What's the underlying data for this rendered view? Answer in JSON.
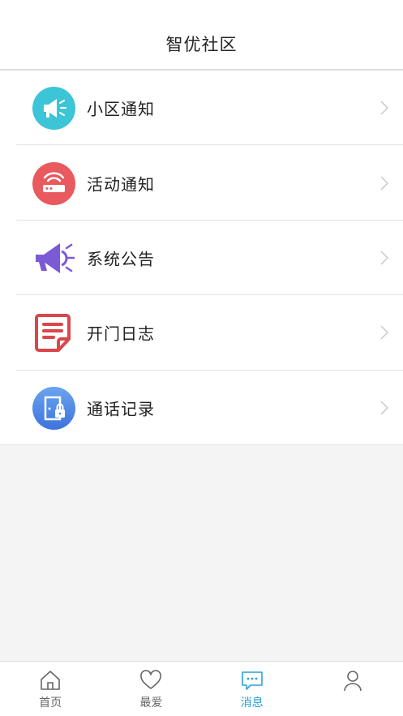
{
  "header": {
    "title": "智优社区"
  },
  "menu": [
    {
      "label": "小区通知",
      "icon": "megaphone-icon",
      "color": "#3cc4d7"
    },
    {
      "label": "活动通知",
      "icon": "router-icon",
      "color": "#e85a5d"
    },
    {
      "label": "系统公告",
      "icon": "megaphone-icon",
      "color": "#7b5ad6"
    },
    {
      "label": "开门日志",
      "icon": "document-icon",
      "color": "#d9474b"
    },
    {
      "label": "通话记录",
      "icon": "door-lock-icon",
      "color": "#4f88e6"
    }
  ],
  "tabbar": {
    "items": [
      {
        "label": "首页",
        "icon": "home-icon"
      },
      {
        "label": "最爱",
        "icon": "heart-icon"
      },
      {
        "label": "消息",
        "icon": "chat-icon",
        "active": true
      },
      {
        "label": "",
        "icon": "user-icon"
      }
    ],
    "active_color": "#27a2d9"
  }
}
